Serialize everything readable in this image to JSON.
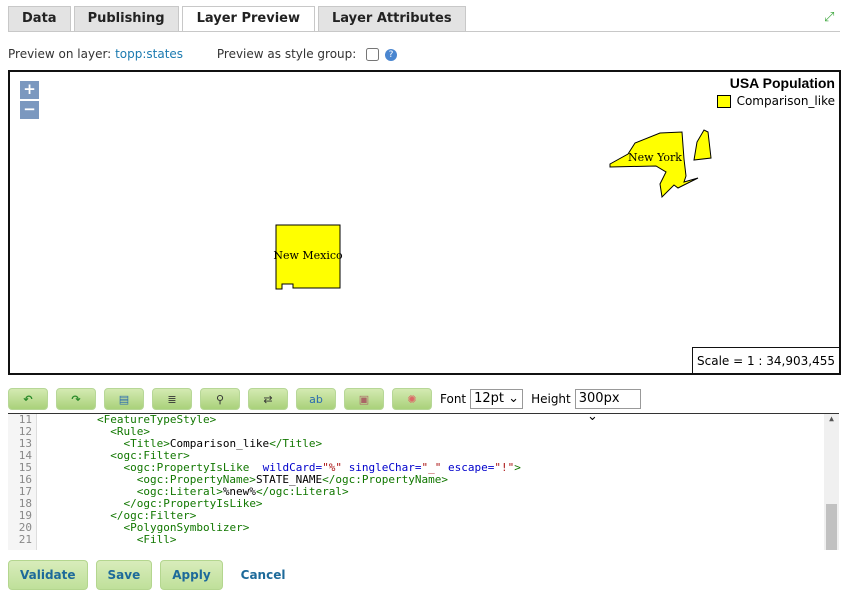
{
  "tabs": [
    {
      "label": "Data"
    },
    {
      "label": "Publishing"
    },
    {
      "label": "Layer Preview",
      "active": true
    },
    {
      "label": "Layer Attributes"
    }
  ],
  "preview": {
    "layer_label": "Preview on layer:",
    "layer_link": "topp:states",
    "group_label": "Preview as style group:",
    "group_checked": false
  },
  "map": {
    "zoom_in": "+",
    "zoom_out": "−",
    "legend_title": "USA Population",
    "legend_item": "Comparison_like",
    "fill_color": "#ffff00",
    "states": [
      "New Mexico",
      "New York"
    ],
    "scale": "Scale = 1 : 34,903,455"
  },
  "toolbar": {
    "icons": [
      "undo-icon",
      "redo-icon",
      "goto-line-icon",
      "reformat-icon",
      "find-icon",
      "replace-icon",
      "font-icon",
      "image-icon",
      "color-palette-icon"
    ],
    "font_label": "Font",
    "font_value": "12pt",
    "height_label": "Height",
    "height_value": "300px"
  },
  "editor": {
    "lines": [
      {
        "n": "11",
        "html": "        <span class='tg'>&lt;FeatureTypeStyle&gt;</span>"
      },
      {
        "n": "12",
        "html": "          <span class='tg'>&lt;Rule&gt;</span>"
      },
      {
        "n": "13",
        "html": "            <span class='tg'>&lt;Title&gt;</span>Comparison_like<span class='tg'>&lt;/Title&gt;</span>"
      },
      {
        "n": "14",
        "html": "          <span class='tg'>&lt;ogc:Filter&gt;</span>"
      },
      {
        "n": "15",
        "html": "            <span class='tg'>&lt;ogc:PropertyIsLike</span>  <span class='at'>wildCard=</span><span class='st'>\"%\"</span> <span class='at'>singleChar=</span><span class='st'>\"_\"</span> <span class='at'>escape=</span><span class='st'>\"!\"</span><span class='tg'>&gt;</span>"
      },
      {
        "n": "16",
        "html": "              <span class='tg'>&lt;ogc:PropertyName&gt;</span>STATE_NAME<span class='tg'>&lt;/ogc:PropertyName&gt;</span>"
      },
      {
        "n": "17",
        "html": "              <span class='tg'>&lt;ogc:Literal&gt;</span>%new%<span class='tg'>&lt;/ogc:Literal&gt;</span>"
      },
      {
        "n": "18",
        "html": "            <span class='tg'>&lt;/ogc:PropertyIsLike&gt;</span>"
      },
      {
        "n": "19",
        "html": "          <span class='tg'>&lt;/ogc:Filter&gt;</span>"
      },
      {
        "n": "20",
        "html": "            <span class='tg'>&lt;PolygonSymbolizer&gt;</span>"
      },
      {
        "n": "21",
        "html": "              <span class='tg'>&lt;Fill&gt;</span>"
      }
    ]
  },
  "actions": {
    "validate": "Validate",
    "save": "Save",
    "apply": "Apply",
    "cancel": "Cancel"
  }
}
